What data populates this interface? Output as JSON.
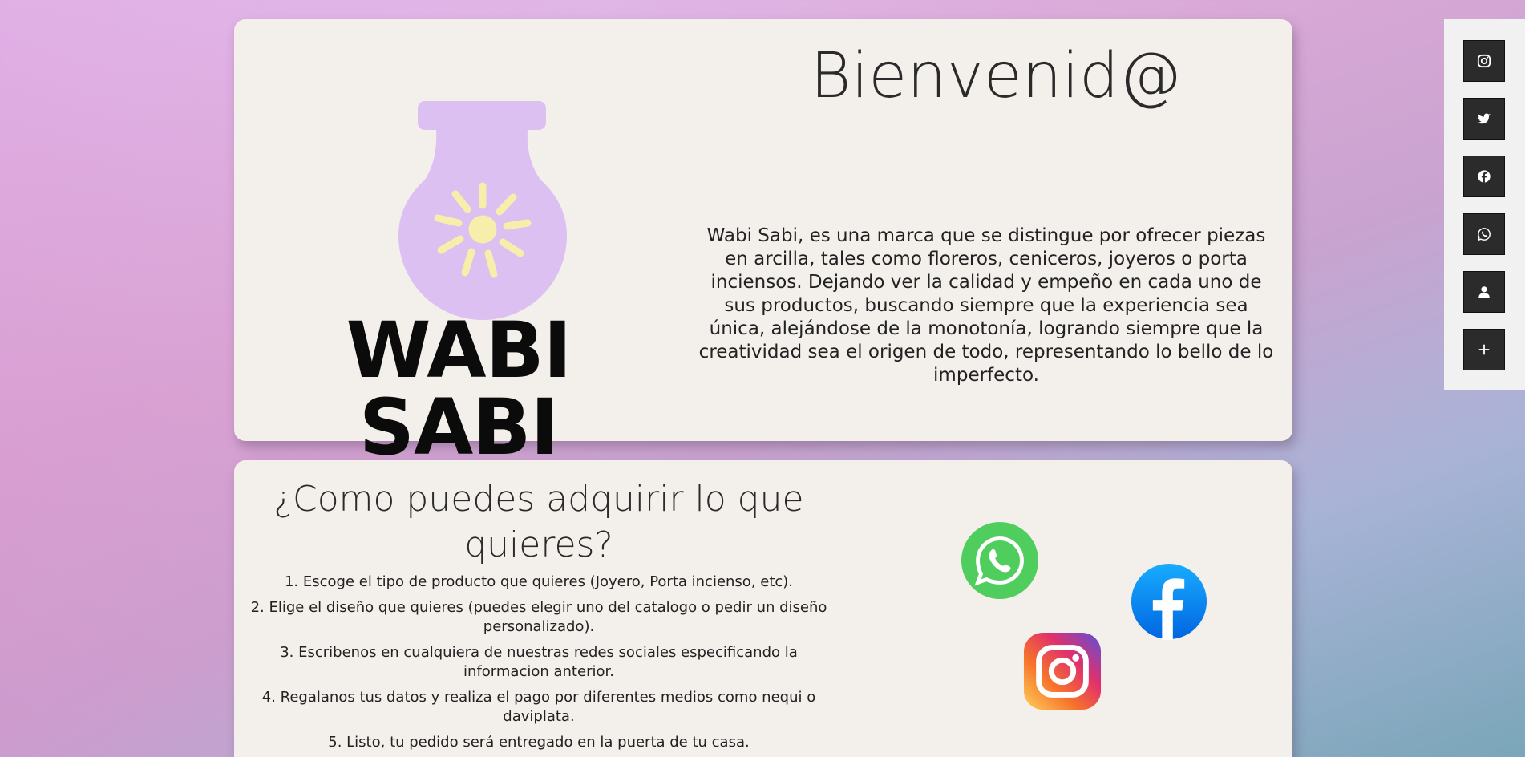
{
  "hero": {
    "brand_name": "WABI SABI",
    "welcome": "Bienvenid@",
    "description": "Wabi Sabi, es una marca que se distingue por ofrecer piezas en arcilla, tales como floreros, ceniceros, joyeros o porta inciensos. Dejando ver la calidad y empeño en cada uno de sus productos, buscando siempre que la experiencia sea única, alejándose de la monotonía, logrando siempre que la creatividad sea el origen de todo, representando lo bello de lo imperfecto."
  },
  "how_to": {
    "title": "¿Como puedes adquirir lo que quieres?",
    "steps": [
      "1. Escoge el tipo de producto que quieres (Joyero, Porta incienso, etc).",
      "2. Elige el diseño que quieres (puedes elegir uno del catalogo o pedir un diseño personalizado).",
      "3. Escribenos en cualquiera de nuestras redes sociales especificando la informacion anterior.",
      "4. Regalanos tus datos y realiza el pago por diferentes medios como nequi o daviplata.",
      "5. Listo, tu pedido será entregado en la puerta de tu casa."
    ],
    "social_icons": [
      "whatsapp-logo",
      "facebook-logo",
      "instagram-logo"
    ]
  },
  "side_menu": {
    "buttons": [
      "instagram-icon",
      "twitter-icon",
      "facebook-icon",
      "whatsapp-icon",
      "user-icon",
      "plus-icon"
    ]
  },
  "colors": {
    "card_bg": "#f3efeb",
    "logo_lilac": "#dcc0f2",
    "sun_yellow": "#f8eeab",
    "side_btn": "#2b2b2b"
  }
}
